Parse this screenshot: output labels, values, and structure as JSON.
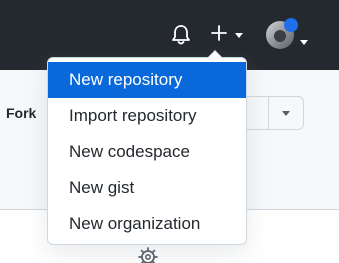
{
  "header": {
    "icons": {
      "bell": "bell-icon",
      "plus": "plus-icon",
      "caret": "triangle-down-icon"
    }
  },
  "repo_actions": {
    "fork_label": "Fork"
  },
  "create_menu": {
    "items": [
      {
        "label": "New repository",
        "active": true
      },
      {
        "label": "Import repository"
      },
      {
        "label": "New codespace"
      },
      {
        "label": "New gist"
      },
      {
        "label": "New organization"
      }
    ]
  },
  "colors": {
    "header_bg": "#24292f",
    "accent": "#0969da",
    "avatar_badge": "#1f6feb"
  }
}
